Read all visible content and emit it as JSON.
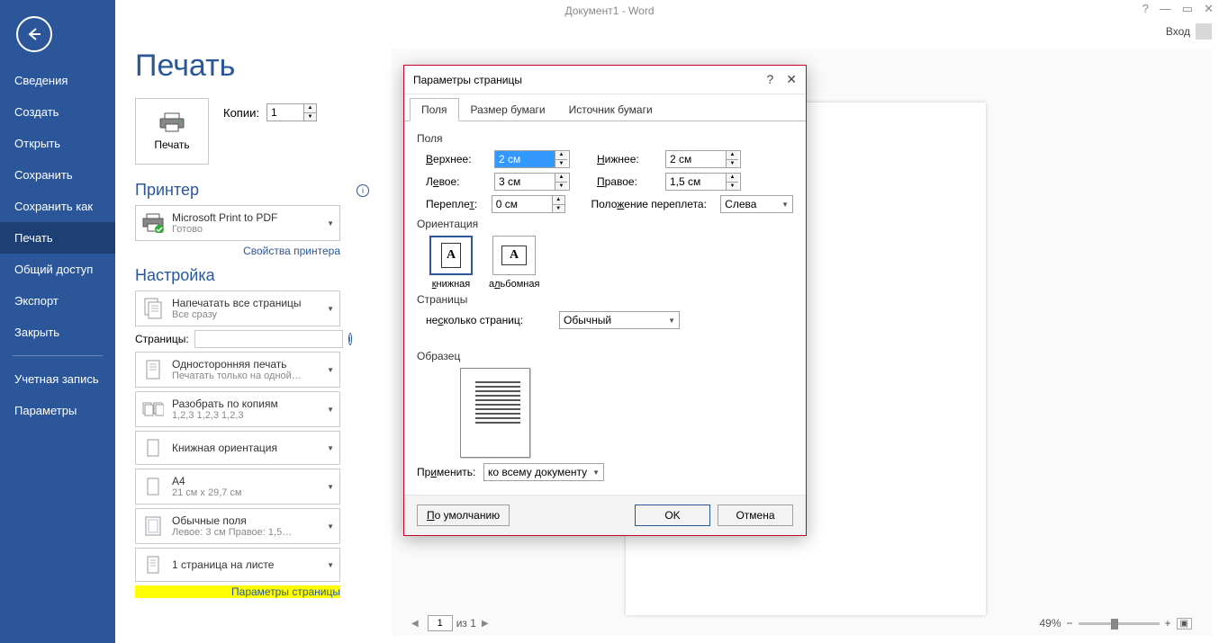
{
  "titlebar": {
    "title": "Документ1 - Word",
    "help": "?",
    "login": "Вход"
  },
  "sidebar": {
    "items": [
      {
        "label": "Сведения"
      },
      {
        "label": "Создать"
      },
      {
        "label": "Открыть"
      },
      {
        "label": "Сохранить"
      },
      {
        "label": "Сохранить как"
      },
      {
        "label": "Печать",
        "active": true
      },
      {
        "label": "Общий доступ"
      },
      {
        "label": "Экспорт"
      },
      {
        "label": "Закрыть"
      }
    ],
    "items2": [
      {
        "label": "Учетная запись"
      },
      {
        "label": "Параметры"
      }
    ]
  },
  "print": {
    "heading": "Печать",
    "printbtn": "Печать",
    "copies_label": "Копии:",
    "copies_value": "1",
    "printer_heading": "Принтер",
    "printer_name": "Microsoft Print to PDF",
    "printer_status": "Готово",
    "printer_props": "Свойства принтера",
    "settings_heading": "Настройка",
    "scope_line1": "Напечатать все страницы",
    "scope_line2": "Все сразу",
    "pages_label": "Страницы:",
    "onesided_line1": "Односторонняя печать",
    "onesided_line2": "Печатать только на одной…",
    "collate_line1": "Разобрать по копиям",
    "collate_line2": "1,2,3    1,2,3    1,2,3",
    "orient_line1": "Книжная ориентация",
    "paper_line1": "A4",
    "paper_line2": "21 см x 29,7 см",
    "margins_line1": "Обычные поля",
    "margins_line2": "Левое:  3 см   Правое:  1,5…",
    "sheets_line1": "1 страница на листе",
    "pagesetup_link": "Параметры страницы"
  },
  "preview": {
    "page": "1",
    "of": "из 1",
    "zoom": "49%"
  },
  "dialog": {
    "title": "Параметры страницы",
    "tabs": [
      "Поля",
      "Размер бумаги",
      "Источник бумаги"
    ],
    "fields_label": "Поля",
    "top_label": "Верхнее:",
    "top_val": "2 см",
    "bottom_label": "Нижнее:",
    "bottom_val": "2 см",
    "left_label": "Левое:",
    "left_val": "3 см",
    "right_label": "Правое:",
    "right_val": "1,5 см",
    "gutter_label": "Переплет:",
    "gutter_val": "0 см",
    "gutterpos_label": "Положение переплета:",
    "gutterpos_val": "Слева",
    "orient_label": "Ориентация",
    "orient_portrait": "книжная",
    "orient_landscape": "альбомная",
    "pages_label": "Страницы",
    "multipage_label": "несколько страниц:",
    "multipage_val": "Обычный",
    "sample_label": "Образец",
    "apply_label": "Применить:",
    "apply_val": "ко всему документу",
    "default_btn": "По умолчанию",
    "ok_btn": "OK",
    "cancel_btn": "Отмена"
  }
}
